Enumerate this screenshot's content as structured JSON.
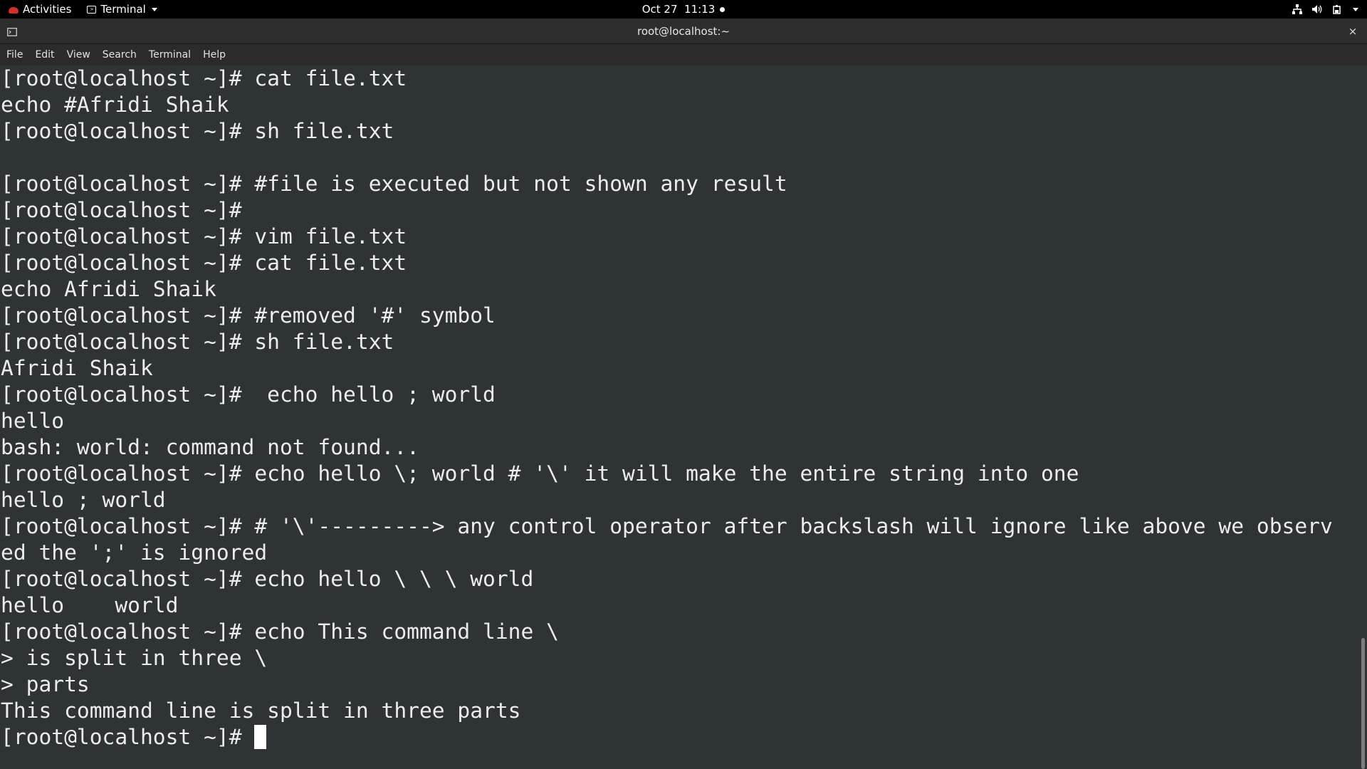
{
  "topbar": {
    "activities": "Activities",
    "app_name": "Terminal",
    "clock": "Oct 27  11:13",
    "icons": [
      "network-icon",
      "volume-icon",
      "power-icon"
    ]
  },
  "window": {
    "title": "root@localhost:~",
    "close_glyph": "×"
  },
  "menubar": {
    "items": [
      "File",
      "Edit",
      "View",
      "Search",
      "Terminal",
      "Help"
    ]
  },
  "terminal": {
    "lines": [
      "[root@localhost ~]# cat file.txt",
      "echo #Afridi Shaik",
      "[root@localhost ~]# sh file.txt",
      "",
      "[root@localhost ~]# #file is executed but not shown any result",
      "[root@localhost ~]#",
      "[root@localhost ~]# vim file.txt",
      "[root@localhost ~]# cat file.txt",
      "echo Afridi Shaik",
      "[root@localhost ~]# #removed '#' symbol",
      "[root@localhost ~]# sh file.txt",
      "Afridi Shaik",
      "[root@localhost ~]#  echo hello ; world",
      "hello",
      "bash: world: command not found...",
      "[root@localhost ~]# echo hello \\; world # '\\' it will make the entire string into one",
      "hello ; world",
      "[root@localhost ~]# # '\\'---------> any control operator after backslash will ignore like above we observ",
      "ed the ';' is ignored",
      "[root@localhost ~]# echo hello \\ \\ \\ world",
      "hello    world",
      "[root@localhost ~]# echo This command line \\",
      "> is split in three \\",
      "> parts",
      "This command line is split in three parts"
    ],
    "prompt": "[root@localhost ~]# "
  }
}
